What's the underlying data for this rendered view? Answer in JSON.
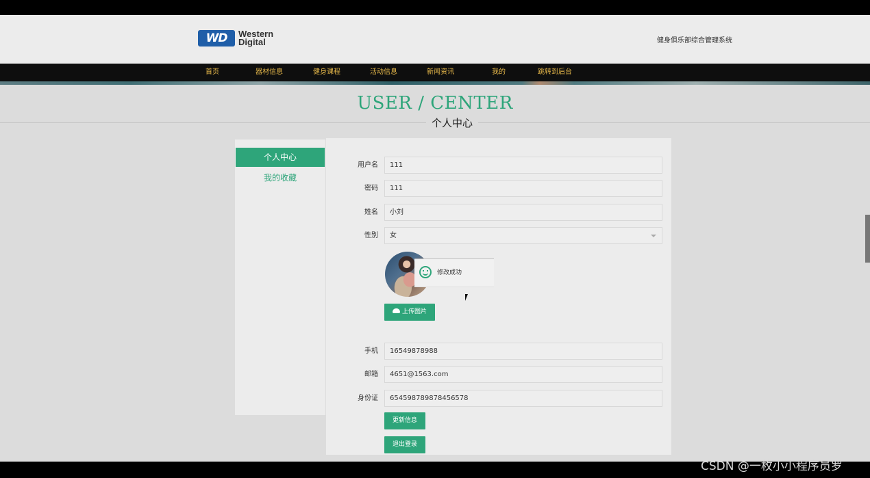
{
  "header": {
    "logo_mark": "WD",
    "logo_line1": "Western",
    "logo_line2": "Digital",
    "site_title": "健身俱乐部综合管理系统"
  },
  "nav": {
    "items": [
      "首页",
      "器材信息",
      "健身课程",
      "活动信息",
      "新闻资讯",
      "我的",
      "跳转到后台"
    ]
  },
  "heading": {
    "en": "USER / CENTER",
    "cn": "个人中心"
  },
  "sidebar": {
    "items": [
      {
        "label": "个人中心",
        "active": true
      },
      {
        "label": "我的收藏",
        "active": false
      }
    ]
  },
  "form": {
    "username_label": "用户名",
    "username_value": "111",
    "password_label": "密码",
    "password_value": "111",
    "name_label": "姓名",
    "name_value": "小刘",
    "gender_label": "性别",
    "gender_value": "女",
    "phone_label": "手机",
    "phone_value": "16549878988",
    "email_label": "邮箱",
    "email_value": "4651@1563.com",
    "idcard_label": "身份证",
    "idcard_value": "654598789878456578",
    "upload_label": "上传图片",
    "update_label": "更新信息",
    "logout_label": "退出登录"
  },
  "toast": {
    "message": "修改成功"
  },
  "watermark": "CSDN @一枚小小程序员罗",
  "colors": {
    "accent": "#2ea57a",
    "nav_bg": "#0e0e0e",
    "nav_text": "#e6b84a"
  }
}
